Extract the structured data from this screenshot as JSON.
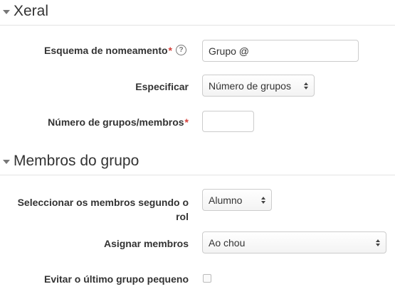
{
  "sections": [
    {
      "title": "Xeral"
    },
    {
      "title": "Membros do grupo"
    }
  ],
  "fields": {
    "naming_scheme": {
      "label": "Esquema de nomeamento",
      "required": "*",
      "value": "Grupo @"
    },
    "specify": {
      "label": "Especificar",
      "selected": "Número de grupos"
    },
    "group_count": {
      "label": "Número de grupos/membros",
      "required": "*",
      "value": ""
    },
    "role": {
      "label_line1": "Seleccionar os membros segundo o",
      "label_line2": "rol",
      "selected": "Alumno"
    },
    "allocate": {
      "label": "Asignar membros",
      "selected": "Ao chou"
    },
    "prevent_last_small": {
      "label": "Evitar o último grupo pequeno",
      "checked": false
    }
  },
  "icons": {
    "help": "help-circle-icon",
    "collapse": "triangle-down-icon"
  },
  "colors": {
    "required": "#d43f3a",
    "text": "#333333"
  }
}
